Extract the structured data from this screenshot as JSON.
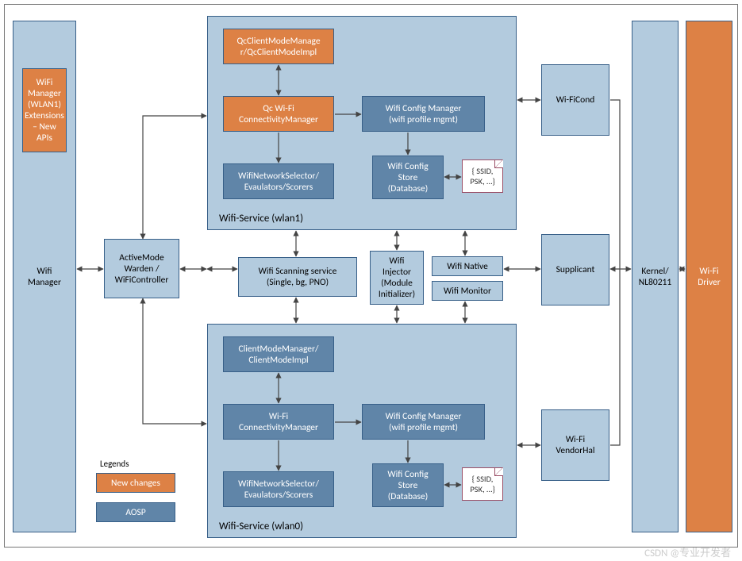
{
  "columns": {
    "wifiManager": "Wifi\nManager",
    "wifiManagerExt": "WiFi\nManager\n(WLAN1)\nExtensions\n– New APIs",
    "activeMode": "ActiveMode\nWarden /\nWiFiController",
    "kernel": "Kernel/\nNL80211",
    "driver": "Wi-Fi\nDriver"
  },
  "wlan1": {
    "label": "Wifi-Service (wlan1)",
    "clientMode": "QcClientModeManage\nr/QcClientModeImpl",
    "connMgr": "Qc Wi-Fi\nConnectivityManager",
    "selector": "WifiNetworkSelector/\nEvaulators/Scorers",
    "cfgMgr": "Wifi Config Manager\n(wifi profile mgmt)",
    "cfgStore": "Wifi Config\nStore\n(Database)",
    "ssidDoc": "{ SSID,\nPSK, …}"
  },
  "wlan0": {
    "label": "Wifi-Service (wlan0)",
    "clientMode": "ClientModeManager/\nClientModeImpl",
    "connMgr": "Wi-Fi\nConnectivityManager",
    "selector": "WifiNetworkSelector/\nEvaulators/Scorers",
    "cfgMgr": "Wifi Config Manager\n(wifi profile mgmt)",
    "cfgStore": "Wifi Config\nStore\n(Database)",
    "ssidDoc": "{ SSID,\nPSK, …}"
  },
  "middle": {
    "scanning": "Wifi Scanning service\n(Single, bg, PNO)",
    "injector": "Wifi\nInjector\n(Module\nInitializer)",
    "native": "Wifi Native",
    "monitor": "Wifi Monitor"
  },
  "right": {
    "wificond": "Wi-FiCond",
    "supplicant": "Supplicant",
    "vendorhal": "Wi-Fi\nVendorHal"
  },
  "legend": {
    "title": "Legends",
    "new": "New changes",
    "aosp": "AOSP"
  },
  "colors": {
    "orange": "#dd8145",
    "darkblue": "#6085a8",
    "lightblue": "#b3cbde"
  },
  "watermark": "CSDN @专业开发者",
  "chart_data": {
    "type": "diagram",
    "title": "Wi-Fi Architecture (dual WLAN) block diagram",
    "nodes": [
      {
        "id": "wifiManager",
        "label": "Wifi Manager",
        "style": "lightblue"
      },
      {
        "id": "wifiExt",
        "label": "WiFi Manager (WLAN1) Extensions – New APIs",
        "style": "orange"
      },
      {
        "id": "activeMode",
        "label": "ActiveModeWarden / WiFiController",
        "style": "lightblue"
      },
      {
        "id": "wlan1",
        "label": "Wifi-Service (wlan1)",
        "style": "lightblue",
        "children": [
          {
            "id": "qcClientMode",
            "label": "QcClientModeManager/QcClientModeImpl",
            "style": "orange"
          },
          {
            "id": "qcConnMgr",
            "label": "Qc Wi-Fi ConnectivityManager",
            "style": "orange"
          },
          {
            "id": "selector1",
            "label": "WifiNetworkSelector/Evaulators/Scorers",
            "style": "darkblue"
          },
          {
            "id": "cfgMgr1",
            "label": "Wifi Config Manager (wifi profile mgmt)",
            "style": "darkblue"
          },
          {
            "id": "cfgStore1",
            "label": "Wifi Config Store (Database)",
            "style": "darkblue"
          },
          {
            "id": "ssid1",
            "label": "{ SSID, PSK, …}",
            "style": "doc"
          }
        ]
      },
      {
        "id": "wlan0",
        "label": "Wifi-Service (wlan0)",
        "style": "lightblue",
        "children": [
          {
            "id": "clientMode",
            "label": "ClientModeManager/ClientModeImpl",
            "style": "darkblue"
          },
          {
            "id": "connMgr",
            "label": "Wi-Fi ConnectivityManager",
            "style": "darkblue"
          },
          {
            "id": "selector0",
            "label": "WifiNetworkSelector/Evaulators/Scorers",
            "style": "darkblue"
          },
          {
            "id": "cfgMgr0",
            "label": "Wifi Config Manager (wifi profile mgmt)",
            "style": "darkblue"
          },
          {
            "id": "cfgStore0",
            "label": "Wifi Config Store (Database)",
            "style": "darkblue"
          },
          {
            "id": "ssid0",
            "label": "{ SSID, PSK, …}",
            "style": "doc"
          }
        ]
      },
      {
        "id": "scanning",
        "label": "Wifi Scanning service (Single, bg, PNO)",
        "style": "lightblue"
      },
      {
        "id": "injector",
        "label": "Wifi Injector (Module Initializer)",
        "style": "lightblue"
      },
      {
        "id": "native",
        "label": "Wifi Native",
        "style": "lightblue"
      },
      {
        "id": "monitor",
        "label": "Wifi Monitor",
        "style": "lightblue"
      },
      {
        "id": "wificond",
        "label": "Wi-FiCond",
        "style": "lightblue"
      },
      {
        "id": "supplicant",
        "label": "Supplicant",
        "style": "lightblue"
      },
      {
        "id": "vendorhal",
        "label": "Wi-Fi VendorHal",
        "style": "lightblue"
      },
      {
        "id": "kernel",
        "label": "Kernel/NL80211",
        "style": "lightblue"
      },
      {
        "id": "driver",
        "label": "Wi-Fi Driver",
        "style": "orange"
      }
    ],
    "edges": [
      {
        "from": "wifiManager",
        "to": "activeMode",
        "dir": "both"
      },
      {
        "from": "activeMode",
        "to": "wlan1",
        "dir": "both"
      },
      {
        "from": "activeMode",
        "to": "wlan0",
        "dir": "both"
      },
      {
        "from": "activeMode",
        "to": "scanning",
        "dir": "both"
      },
      {
        "from": "qcClientMode",
        "to": "qcConnMgr",
        "dir": "both"
      },
      {
        "from": "qcConnMgr",
        "to": "selector1",
        "dir": "fwd"
      },
      {
        "from": "qcConnMgr",
        "to": "cfgMgr1",
        "dir": "fwd"
      },
      {
        "from": "cfgMgr1",
        "to": "cfgStore1",
        "dir": "fwd"
      },
      {
        "from": "cfgStore1",
        "to": "ssid1",
        "dir": "both"
      },
      {
        "from": "clientMode",
        "to": "connMgr",
        "dir": "both"
      },
      {
        "from": "connMgr",
        "to": "selector0",
        "dir": "fwd"
      },
      {
        "from": "connMgr",
        "to": "cfgMgr0",
        "dir": "fwd"
      },
      {
        "from": "cfgMgr0",
        "to": "cfgStore0",
        "dir": "fwd"
      },
      {
        "from": "cfgStore0",
        "to": "ssid0",
        "dir": "both"
      },
      {
        "from": "scanning",
        "to": "wlan1",
        "dir": "both"
      },
      {
        "from": "scanning",
        "to": "wlan0",
        "dir": "both"
      },
      {
        "from": "injector",
        "to": "wlan1",
        "dir": "both"
      },
      {
        "from": "injector",
        "to": "wlan0",
        "dir": "both"
      },
      {
        "from": "native",
        "to": "wlan1",
        "dir": "both"
      },
      {
        "from": "monitor",
        "to": "wlan0",
        "dir": "both"
      },
      {
        "from": "wlan1",
        "to": "wificond",
        "dir": "both"
      },
      {
        "from": "native",
        "to": "supplicant",
        "dir": "both"
      },
      {
        "from": "wlan0",
        "to": "vendorhal",
        "dir": "both"
      },
      {
        "from": "wificond",
        "to": "kernel",
        "dir": "both"
      },
      {
        "from": "supplicant",
        "to": "kernel",
        "dir": "both"
      },
      {
        "from": "vendorhal",
        "to": "kernel",
        "dir": "both"
      },
      {
        "from": "kernel",
        "to": "driver",
        "dir": "both"
      }
    ],
    "legend": [
      {
        "label": "New changes",
        "style": "orange"
      },
      {
        "label": "AOSP",
        "style": "darkblue"
      }
    ]
  }
}
